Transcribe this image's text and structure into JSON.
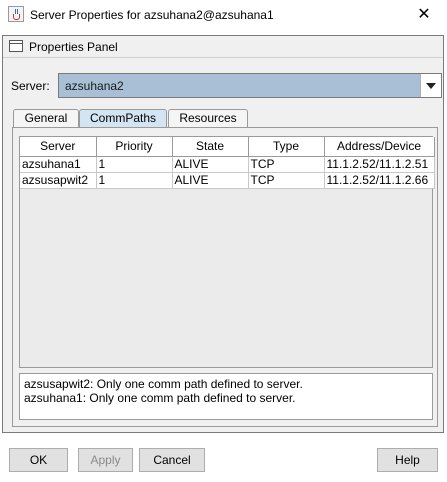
{
  "window": {
    "title": "Server Properties for azsuhana2@azsuhana1",
    "close_glyph": "✕"
  },
  "panel": {
    "title": "Properties Panel"
  },
  "server_selector": {
    "label": "Server:",
    "value": "azsuhana2"
  },
  "tabs": [
    {
      "label": "General",
      "active": false
    },
    {
      "label": "CommPaths",
      "active": true
    },
    {
      "label": "Resources",
      "active": false
    }
  ],
  "table": {
    "headers": [
      "Server",
      "Priority",
      "State",
      "Type",
      "Address/Device"
    ],
    "rows": [
      [
        "azsuhana1",
        "1",
        "ALIVE",
        "TCP",
        "11.1.2.52/11.1.2.51"
      ],
      [
        "azsusapwit2",
        "1",
        "ALIVE",
        "TCP",
        "11.1.2.52/11.1.2.66"
      ]
    ]
  },
  "messages": [
    "azsusapwit2: Only one comm path defined to server.",
    "azsuhana1: Only one comm path defined to server."
  ],
  "buttons": {
    "ok": "OK",
    "apply": "Apply",
    "cancel": "Cancel",
    "help": "Help"
  },
  "colors": {
    "selector_bg": "#a8bfd6",
    "active_tab_bg": "#d3e4f3"
  }
}
